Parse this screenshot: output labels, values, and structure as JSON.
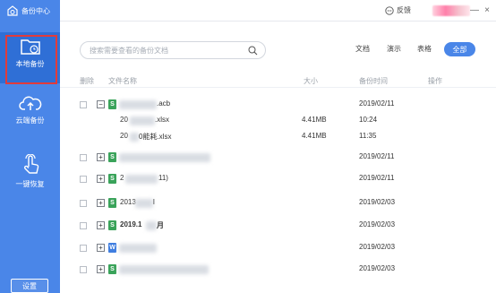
{
  "app": {
    "title": "备份中心"
  },
  "sidebar": {
    "items": [
      {
        "label": "本地备份",
        "icon": "local-backup-folder-icon",
        "active": true
      },
      {
        "label": "云端备份",
        "icon": "cloud-upload-icon",
        "active": false
      },
      {
        "label": "一键恢复",
        "icon": "tap-hand-icon",
        "active": false
      }
    ],
    "settings_label": "设置"
  },
  "topbar": {
    "feedback_label": "反馈",
    "minimize_symbol": "—",
    "close_symbol": "×"
  },
  "search": {
    "placeholder": "搜索需要查看的备份文档"
  },
  "filters": {
    "doc": "文档",
    "slides": "演示",
    "sheet": "表格",
    "all": "全部"
  },
  "table": {
    "headers": {
      "delete": "删除",
      "name": "文件名称",
      "size": "大小",
      "time": "备份时间",
      "action": "操作"
    },
    "rows": [
      {
        "expand": "−",
        "icon": "S",
        "name": ".acb",
        "date": "2019/02/11"
      },
      {
        "sub": true,
        "name": "20",
        "name2": ".xlsx",
        "size": "4.41MB",
        "date": "10:24"
      },
      {
        "sub": true,
        "name": "20",
        "name2": "0能耗.xlsx",
        "size": "4.41MB",
        "date": "11:35"
      },
      {
        "expand": "+",
        "icon": "S",
        "name": "",
        "date": "2019/02/11"
      },
      {
        "expand": "+",
        "icon": "S",
        "name": "2",
        "name2": "11)",
        "date": "2019/02/11"
      },
      {
        "expand": "+",
        "icon": "S",
        "name": "2019.1",
        "name2": "月",
        "date": "2019/02/03",
        "bold": true
      },
      {
        "expand": "+",
        "icon": "S",
        "name": "2013",
        "name2": "l",
        "date": "2019/02/03"
      },
      {
        "expand": "+",
        "icon": "W",
        "name": "",
        "date": "2019/02/03"
      },
      {
        "expand": "+",
        "icon": "S",
        "name": "",
        "date": "2019/02/03"
      }
    ]
  },
  "colors": {
    "sidebar": "#4a86e8",
    "accent": "#4a86e8",
    "highlight_border": "#e23b3b"
  }
}
